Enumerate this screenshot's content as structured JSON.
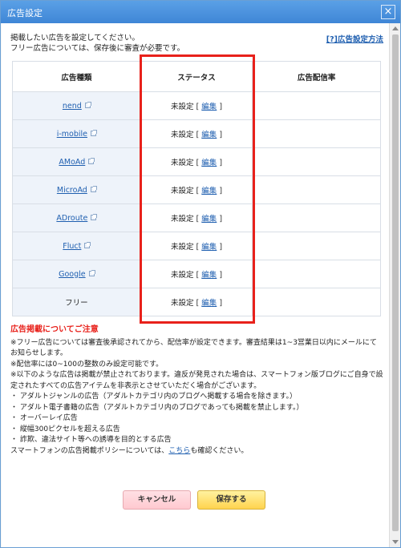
{
  "window": {
    "title": "広告設定",
    "close_glyph": "×"
  },
  "intro": {
    "line1": "掲載したい広告を設定してください。",
    "line2": "フリー広告については、保存後に審査が必要です。"
  },
  "help_link": "[?]広告設定方法",
  "table": {
    "headers": [
      "広告種類",
      "ステータス",
      "広告配信率"
    ],
    "rows": [
      {
        "name": "nend",
        "link": true,
        "status": "未設定",
        "edit": "編集"
      },
      {
        "name": "i-mobile",
        "link": true,
        "status": "未設定",
        "edit": "編集"
      },
      {
        "name": "AMoAd",
        "link": true,
        "status": "未設定",
        "edit": "編集"
      },
      {
        "name": "MicroAd",
        "link": true,
        "status": "未設定",
        "edit": "編集"
      },
      {
        "name": "ADroute",
        "link": true,
        "status": "未設定",
        "edit": "編集"
      },
      {
        "name": "Fluct",
        "link": true,
        "status": "未設定",
        "edit": "編集"
      },
      {
        "name": "Google",
        "link": true,
        "status": "未設定",
        "edit": "編集"
      },
      {
        "name": "フリー",
        "link": false,
        "status": "未設定",
        "edit": "編集"
      }
    ]
  },
  "notice": {
    "title": "広告掲載についてご注意",
    "lines": [
      "※フリー広告については審査後承認されてから、配信率が設定できます。審査結果は1~3営業日以内にメールにてお知らせします。",
      "※配信率には0~100の整数のみ設定可能です。",
      "※以下のような広告は掲載が禁止されております。違反が発見された場合は、スマートフォン版ブログにご自身で設定されたすべての広告アイテムを非表示とさせていただく場合がございます。",
      "・ アダルトジャンルの広告（アダルトカテゴリ内のブログへ掲載する場合を除きます。）",
      "・ アダルト電子書籍の広告（アダルトカテゴリ内のブログであっても掲載を禁止します。）",
      "・ オーバーレイ広告",
      "・ 縦幅300ピクセルを超える広告",
      "・ 詐欺、違法サイト等への誘導を目的とする広告"
    ],
    "policy_prefix": "スマートフォンの広告掲載ポリシーについては、",
    "policy_link": "こちら",
    "policy_suffix": "も確認ください。"
  },
  "buttons": {
    "cancel": "キャンセル",
    "save": "保存する"
  },
  "colors": {
    "accent": "#e8211b",
    "link": "#1f5fb0",
    "titlebar": "#4a92df"
  }
}
